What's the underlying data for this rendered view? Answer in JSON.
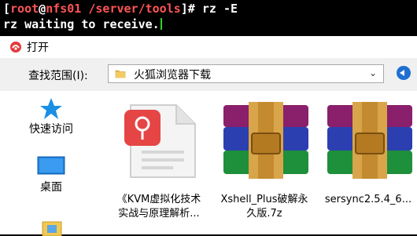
{
  "terminal": {
    "line1_open": "[",
    "user": "root",
    "at": "@",
    "host": "nfs01",
    "space": " ",
    "path": "/server/tools",
    "line1_close": "]# ",
    "command": "rz -E",
    "line2": "rz waiting to receive."
  },
  "dialog": {
    "title": "打开",
    "lookin_label": "查找范围(I):",
    "lookin_value": "火狐浏览器下载"
  },
  "sidebar": {
    "items": [
      {
        "label": "快速访问"
      },
      {
        "label": "桌面"
      }
    ]
  },
  "files": [
    {
      "line1": "《KVM虚拟化技术",
      "line2": "实战与原理解析..."
    },
    {
      "line1": "Xshell_Plus破解永",
      "line2": "久版.7z"
    },
    {
      "line1": "sersync2.5.4_6...",
      "line2": ""
    }
  ],
  "colors": {
    "terminal_bg": "#000000",
    "prompt_red": "#ff5555",
    "cursor_green": "#2bd42b",
    "dialog_bg": "#f0f0f0",
    "accent_blue": "#1f6fd1"
  }
}
